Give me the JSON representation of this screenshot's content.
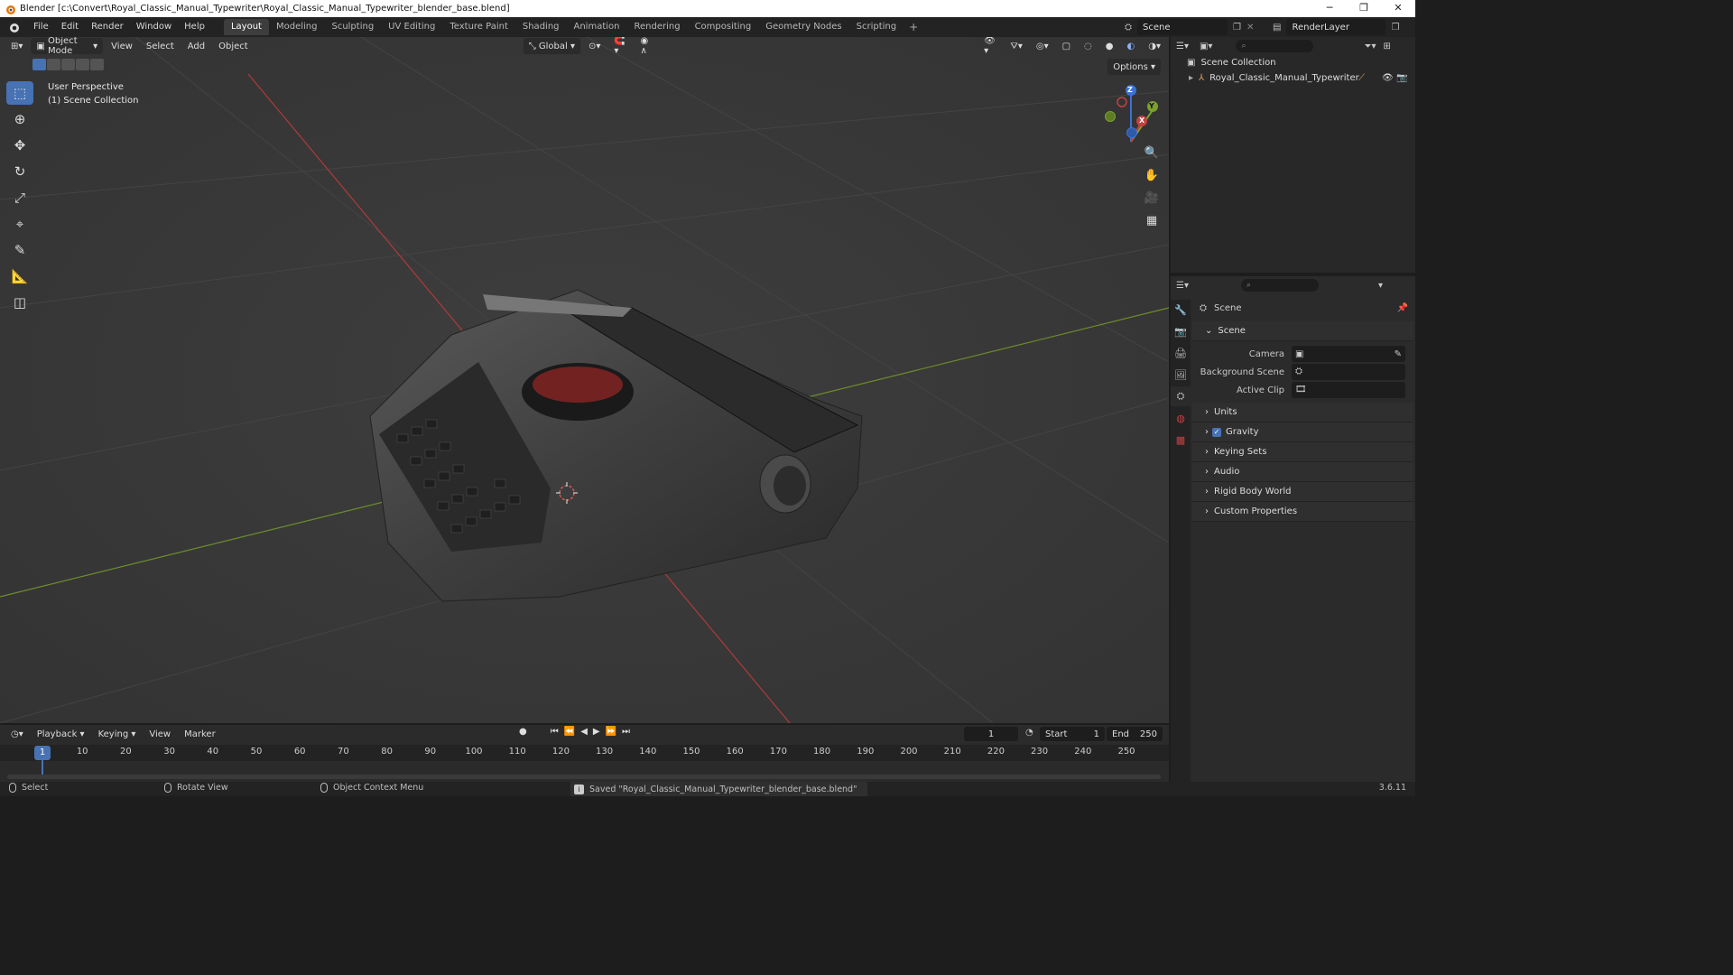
{
  "window": {
    "title": "Blender [c:\\Convert\\Royal_Classic_Manual_Typewriter\\Royal_Classic_Manual_Typewriter_blender_base.blend]",
    "controls": [
      "─",
      "❐",
      "✕"
    ]
  },
  "menu": [
    "File",
    "Edit",
    "Render",
    "Window",
    "Help"
  ],
  "workspaces": {
    "active": "Layout",
    "tabs": [
      "Layout",
      "Modeling",
      "Sculpting",
      "UV Editing",
      "Texture Paint",
      "Shading",
      "Animation",
      "Rendering",
      "Compositing",
      "Geometry Nodes",
      "Scripting"
    ],
    "add": "+"
  },
  "scene_selector": {
    "value": "Scene"
  },
  "viewlayer_selector": {
    "value": "RenderLayer"
  },
  "viewport": {
    "mode": "Object Mode",
    "menus": [
      "View",
      "Select",
      "Add",
      "Object"
    ],
    "transform_orientation": "Global",
    "options_label": "Options",
    "info_line1": "User Perspective",
    "info_line2": "(1) Scene Collection",
    "gizmo": {
      "z": "Z",
      "y": "Y",
      "x": "X"
    }
  },
  "outliner": {
    "root": "Scene Collection",
    "items": [
      {
        "name": "Royal_Classic_Manual_Typewriter"
      }
    ]
  },
  "properties": {
    "context": "Scene",
    "section": "Scene",
    "fields": [
      {
        "label": "Camera"
      },
      {
        "label": "Background Scene"
      },
      {
        "label": "Active Clip"
      }
    ],
    "panels": [
      {
        "label": "Units",
        "checkbox": false
      },
      {
        "label": "Gravity",
        "checkbox": true
      },
      {
        "label": "Keying Sets",
        "checkbox": false
      },
      {
        "label": "Audio",
        "checkbox": false
      },
      {
        "label": "Rigid Body World",
        "checkbox": false
      },
      {
        "label": "Custom Properties",
        "checkbox": false
      }
    ]
  },
  "timeline": {
    "menus": [
      "Playback",
      "Keying",
      "View",
      "Marker"
    ],
    "current_frame": "1",
    "start_label": "Start",
    "start": "1",
    "end_label": "End",
    "end": "250",
    "ruler": [
      "1",
      "10",
      "20",
      "30",
      "40",
      "50",
      "60",
      "70",
      "80",
      "90",
      "100",
      "110",
      "120",
      "130",
      "140",
      "150",
      "160",
      "170",
      "180",
      "190",
      "200",
      "210",
      "220",
      "230",
      "240",
      "250"
    ]
  },
  "statusbar": {
    "select": "Select",
    "rotate": "Rotate View",
    "context_menu": "Object Context Menu",
    "message": "Saved \"Royal_Classic_Manual_Typewriter_blender_base.blend\"",
    "version": "3.6.11"
  },
  "colors": {
    "accent": "#4772b3",
    "x_axis": "#c44040",
    "y_axis": "#7aa02e"
  }
}
